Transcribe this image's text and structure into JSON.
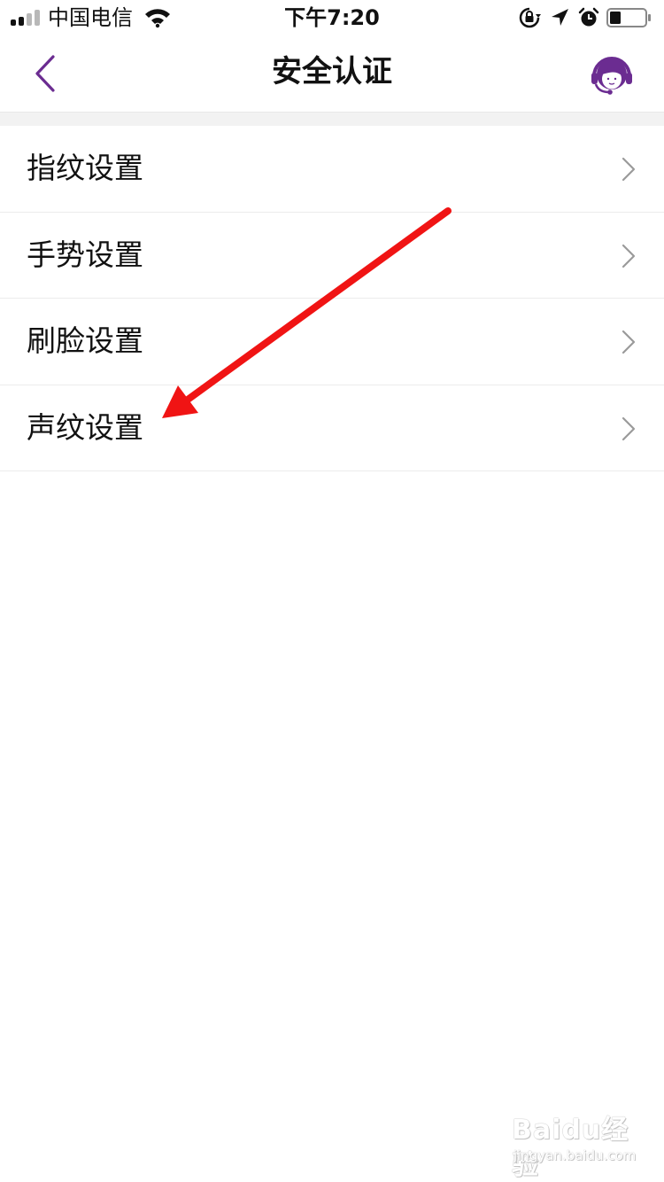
{
  "status_bar": {
    "carrier": "中国电信",
    "time": "下午7:20",
    "icons": [
      "signal-icon",
      "wifi-icon",
      "rotation-lock-icon",
      "location-icon",
      "alarm-icon",
      "battery-icon"
    ]
  },
  "nav": {
    "title": "安全认证",
    "back_icon": "chevron-left-icon",
    "service_icon": "customer-service-icon",
    "accent_color": "#6b2c91"
  },
  "list": {
    "items": [
      {
        "label": "指纹设置"
      },
      {
        "label": "手势设置"
      },
      {
        "label": "刷脸设置"
      },
      {
        "label": "声纹设置"
      }
    ],
    "chevron_icon": "chevron-right-icon"
  },
  "annotation": {
    "arrow_color": "#f01414",
    "points_to": "声纹设置"
  },
  "watermark": {
    "main": "Baidu经验",
    "sub": "jingyan.baidu.com"
  }
}
